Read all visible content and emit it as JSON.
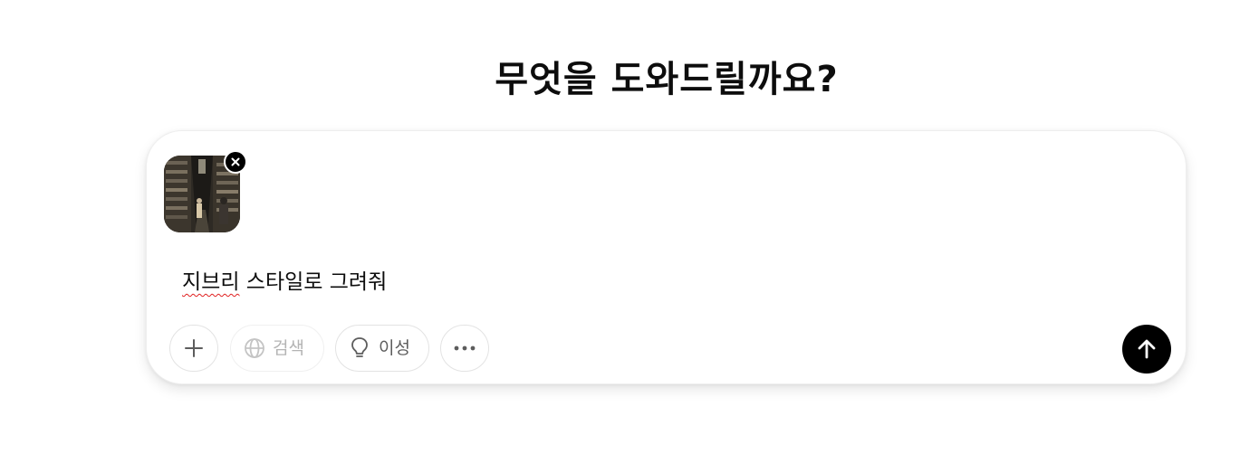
{
  "heading": "무엇을 도와드릴까요?",
  "composer": {
    "prompt_parts": {
      "misspelled": "지브리",
      "rest": " 스타일로 그려줘"
    },
    "attachment_icon": "close-icon",
    "toolbar": {
      "attach_icon": "plus-icon",
      "search_label": "검색",
      "search_icon": "globe-icon",
      "reason_label": "이성",
      "reason_icon": "lightbulb-icon",
      "more_icon": "ellipsis-icon",
      "send_icon": "arrow-up-icon"
    }
  },
  "colors": {
    "send_button": "#000000",
    "disabled_text": "#b4b4b4",
    "spellcheck": "#e02020"
  }
}
